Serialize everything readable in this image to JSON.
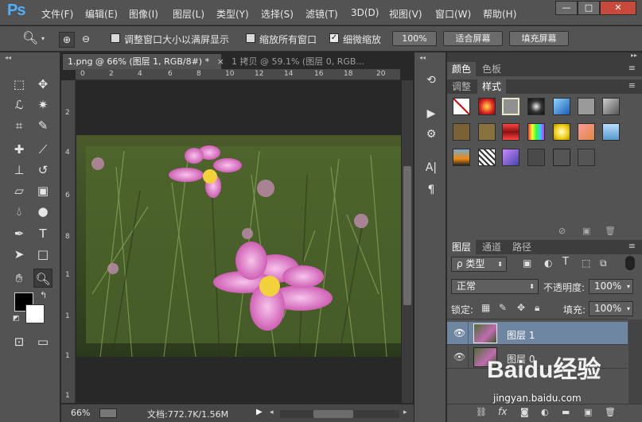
{
  "app": {
    "logo": "Ps"
  },
  "menu": [
    "文件(F)",
    "编辑(E)",
    "图像(I)",
    "图层(L)",
    "类型(Y)",
    "选择(S)",
    "滤镜(T)",
    "3D(D)",
    "视图(V)",
    "窗口(W)",
    "帮助(H)"
  ],
  "window_controls": {
    "minimize": "—",
    "maximize": "□",
    "close": "✕"
  },
  "options": {
    "resize_windows_label": "调整窗口大小以满屏显示",
    "resize_windows_checked": false,
    "zoom_all_label": "缩放所有窗口",
    "zoom_all_checked": false,
    "scrubby_zoom_label": "细微缩放",
    "scrubby_zoom_checked": true,
    "btn_100": "100%",
    "btn_fit": "适合屏幕",
    "btn_fill": "填充屏幕"
  },
  "tabs": [
    {
      "label": "1.png @ 66% (图层 1, RGB/8#) *",
      "close": "×",
      "active": true
    },
    {
      "label": "1 拷贝 @ 59.1% (图层 0, RGB...",
      "close": "",
      "active": false
    }
  ],
  "rulers": {
    "top": [
      "0",
      "2",
      "4",
      "6",
      "8",
      "10",
      "12",
      "14",
      "16",
      "18",
      "20"
    ],
    "left": [
      "2",
      "4",
      "6",
      "8",
      "1",
      "1",
      "1",
      "1"
    ]
  },
  "status": {
    "zoom": "66%",
    "doc": "文档:772.7K/1.56M"
  },
  "panels": {
    "color_tabs": [
      "颜色",
      "色板"
    ],
    "style_tabs": [
      "调整",
      "样式"
    ],
    "layer_tabs": [
      "图层",
      "通道",
      "路径"
    ]
  },
  "layers_panel": {
    "filter": "ρ 类型",
    "blend_mode": "正常",
    "opacity_label": "不透明度:",
    "opacity_value": "100%",
    "lock_label": "锁定:",
    "fill_label": "填充:",
    "fill_value": "100%",
    "layers": [
      {
        "name": "图层 1",
        "visible": true,
        "selected": true
      },
      {
        "name": "图层 0",
        "visible": true,
        "selected": false
      }
    ]
  },
  "watermark": {
    "brand": "Baidu经验",
    "url": "jingyan.baidu.com"
  },
  "colors": {
    "accent": "#4fb0ff",
    "selected_layer": "#6f86a3",
    "bg_panel": "#535353"
  }
}
